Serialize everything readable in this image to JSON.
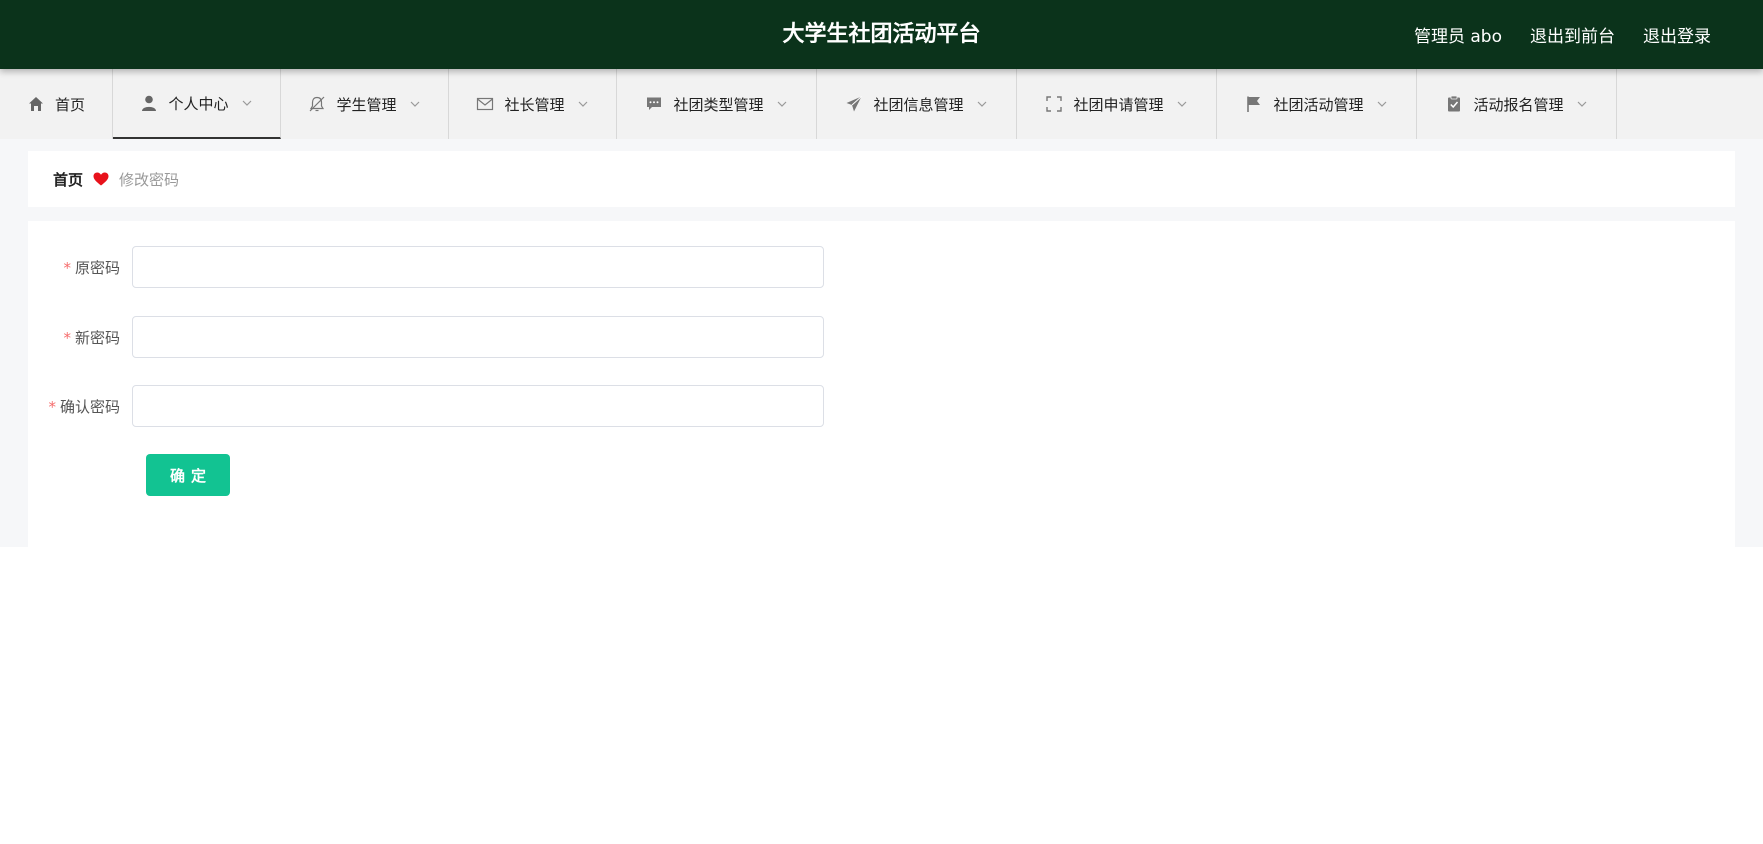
{
  "header": {
    "title": "大学生社团活动平台",
    "user_label": "管理员 abo",
    "to_front_label": "退出到前台",
    "logout_label": "退出登录",
    "bg_color": "#0b331b"
  },
  "nav": {
    "items": [
      {
        "label": "首页",
        "icon": "home-icon",
        "has_dropdown": false
      },
      {
        "label": "个人中心",
        "icon": "user-icon",
        "has_dropdown": true,
        "active": true
      },
      {
        "label": "学生管理",
        "icon": "bell-off-icon",
        "has_dropdown": true
      },
      {
        "label": "社长管理",
        "icon": "envelope-icon",
        "has_dropdown": true
      },
      {
        "label": "社团类型管理",
        "icon": "chat-icon",
        "has_dropdown": true
      },
      {
        "label": "社团信息管理",
        "icon": "send-icon",
        "has_dropdown": true
      },
      {
        "label": "社团申请管理",
        "icon": "fullscreen-icon",
        "has_dropdown": true
      },
      {
        "label": "社团活动管理",
        "icon": "flag-icon",
        "has_dropdown": true
      },
      {
        "label": "活动报名管理",
        "icon": "clipboard-check-icon",
        "has_dropdown": true
      }
    ]
  },
  "breadcrumb": {
    "home": "首页",
    "separator_icon": "heart-icon",
    "current": "修改密码"
  },
  "form": {
    "old_password": {
      "label": "原密码",
      "required_mark": "*",
      "value": ""
    },
    "new_password": {
      "label": "新密码",
      "required_mark": "*",
      "value": ""
    },
    "confirm_password": {
      "label": "确认密码",
      "required_mark": "*",
      "value": ""
    },
    "submit_label": "确定",
    "accent_color": "#12c392"
  }
}
